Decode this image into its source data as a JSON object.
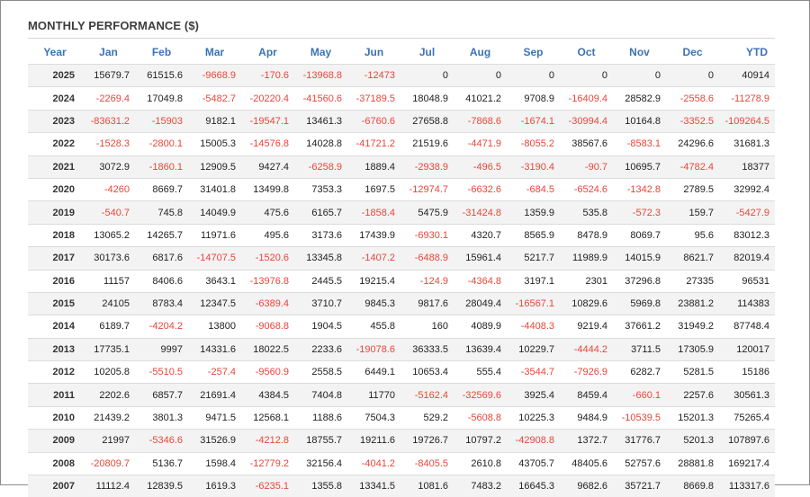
{
  "panel": {
    "title": "MONTHLY PERFORMANCE ($)"
  },
  "table": {
    "headers": [
      "Year",
      "Jan",
      "Feb",
      "Mar",
      "Apr",
      "May",
      "Jun",
      "Jul",
      "Aug",
      "Sep",
      "Oct",
      "Nov",
      "Dec",
      "YTD"
    ],
    "rows": [
      [
        "2025",
        "15679.7",
        "61515.6",
        "-9668.9",
        "-170.6",
        "-13968.8",
        "-12473",
        "0",
        "0",
        "0",
        "0",
        "0",
        "0",
        "40914"
      ],
      [
        "2024",
        "-2269.4",
        "17049.8",
        "-5482.7",
        "-20220.4",
        "-41560.6",
        "-37189.5",
        "18048.9",
        "41021.2",
        "9708.9",
        "-16409.4",
        "28582.9",
        "-2558.6",
        "-11278.9"
      ],
      [
        "2023",
        "-83631.2",
        "-15903",
        "9182.1",
        "-19547.1",
        "13461.3",
        "-6760.6",
        "27658.8",
        "-7868.6",
        "-1674.1",
        "-30994.4",
        "10164.8",
        "-3352.5",
        "-109264.5"
      ],
      [
        "2022",
        "-1528.3",
        "-2800.1",
        "15005.3",
        "-14576.8",
        "14028.8",
        "-41721.2",
        "21519.6",
        "-4471.9",
        "-8055.2",
        "38567.6",
        "-8583.1",
        "24296.6",
        "31681.3"
      ],
      [
        "2021",
        "3072.9",
        "-1860.1",
        "12909.5",
        "9427.4",
        "-6258.9",
        "1889.4",
        "-2938.9",
        "-496.5",
        "-3190.4",
        "-90.7",
        "10695.7",
        "-4782.4",
        "18377"
      ],
      [
        "2020",
        "-4260",
        "8669.7",
        "31401.8",
        "13499.8",
        "7353.3",
        "1697.5",
        "-12974.7",
        "-6632.6",
        "-684.5",
        "-6524.6",
        "-1342.8",
        "2789.5",
        "32992.4"
      ],
      [
        "2019",
        "-540.7",
        "745.8",
        "14049.9",
        "475.6",
        "6165.7",
        "-1858.4",
        "5475.9",
        "-31424.8",
        "1359.9",
        "535.8",
        "-572.3",
        "159.7",
        "-5427.9"
      ],
      [
        "2018",
        "13065.2",
        "14265.7",
        "11971.6",
        "495.6",
        "3173.6",
        "17439.9",
        "-6930.1",
        "4320.7",
        "8565.9",
        "8478.9",
        "8069.7",
        "95.6",
        "83012.3"
      ],
      [
        "2017",
        "30173.6",
        "6817.6",
        "-14707.5",
        "-1520.6",
        "13345.8",
        "-1407.2",
        "-6488.9",
        "15961.4",
        "5217.7",
        "11989.9",
        "14015.9",
        "8621.7",
        "82019.4"
      ],
      [
        "2016",
        "11157",
        "8406.6",
        "3643.1",
        "-13976.8",
        "2445.5",
        "19215.4",
        "-124.9",
        "-4364.8",
        "3197.1",
        "2301",
        "37296.8",
        "27335",
        "96531"
      ],
      [
        "2015",
        "24105",
        "8783.4",
        "12347.5",
        "-6389.4",
        "3710.7",
        "9845.3",
        "9817.6",
        "28049.4",
        "-16567.1",
        "10829.6",
        "5969.8",
        "23881.2",
        "114383"
      ],
      [
        "2014",
        "6189.7",
        "-4204.2",
        "13800",
        "-9068.8",
        "1904.5",
        "455.8",
        "160",
        "4089.9",
        "-4408.3",
        "9219.4",
        "37661.2",
        "31949.2",
        "87748.4"
      ],
      [
        "2013",
        "17735.1",
        "9997",
        "14331.6",
        "18022.5",
        "2233.6",
        "-19078.6",
        "36333.5",
        "13639.4",
        "10229.7",
        "-4444.2",
        "3711.5",
        "17305.9",
        "120017"
      ],
      [
        "2012",
        "10205.8",
        "-5510.5",
        "-257.4",
        "-9560.9",
        "2558.5",
        "6449.1",
        "10653.4",
        "555.4",
        "-3544.7",
        "-7926.9",
        "6282.7",
        "5281.5",
        "15186"
      ],
      [
        "2011",
        "2202.6",
        "6857.7",
        "21691.4",
        "4384.5",
        "7404.8",
        "11770",
        "-5162.4",
        "-32569.6",
        "3925.4",
        "8459.4",
        "-660.1",
        "2257.6",
        "30561.3"
      ],
      [
        "2010",
        "21439.2",
        "3801.3",
        "9471.5",
        "12568.1",
        "1188.6",
        "7504.3",
        "529.2",
        "-5608.8",
        "10225.3",
        "9484.9",
        "-10539.5",
        "15201.3",
        "75265.4"
      ],
      [
        "2009",
        "21997",
        "-5346.6",
        "31526.9",
        "-4212.8",
        "18755.7",
        "19211.6",
        "19726.7",
        "10797.2",
        "-42908.8",
        "1372.7",
        "31776.7",
        "5201.3",
        "107897.6"
      ],
      [
        "2008",
        "-20809.7",
        "5136.7",
        "1598.4",
        "-12779.2",
        "32156.4",
        "-4041.2",
        "-8405.5",
        "2610.8",
        "43705.7",
        "48405.6",
        "52757.6",
        "28881.8",
        "169217.4"
      ],
      [
        "2007",
        "11112.4",
        "12839.5",
        "1619.3",
        "-6235.1",
        "1355.8",
        "13341.5",
        "1081.6",
        "7483.2",
        "16645.3",
        "9682.6",
        "35721.7",
        "8669.8",
        "113317.6"
      ]
    ]
  },
  "colors": {
    "header_text": "#3b73b6",
    "negative_text": "#e8463a",
    "positive_text": "#222222",
    "stripe_background": "#f3f3f3"
  }
}
